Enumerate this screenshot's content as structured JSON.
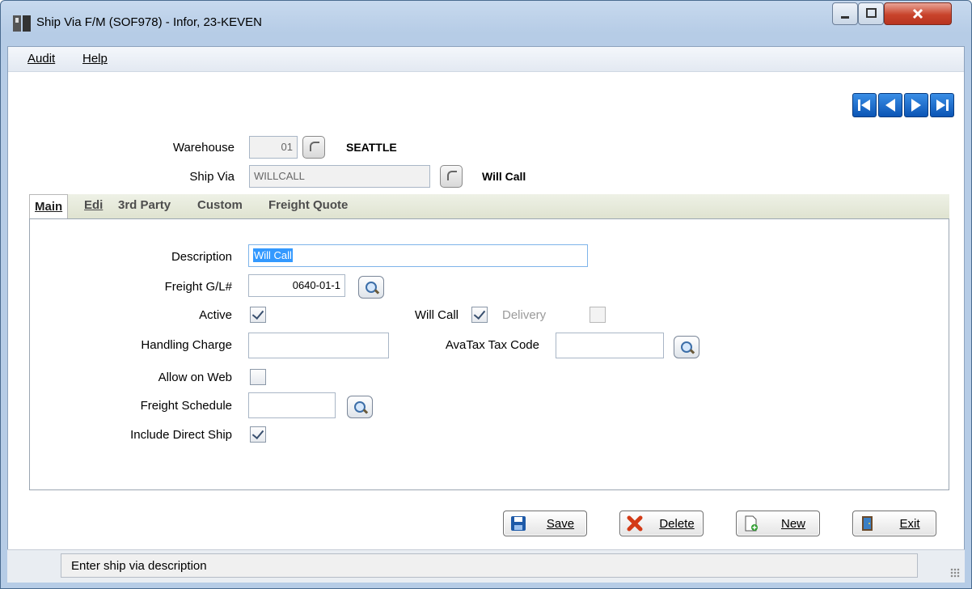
{
  "window": {
    "title": "Ship Via F/M (SOF978) - Infor, 23-KEVEN"
  },
  "menu": [
    "Audit",
    "Help"
  ],
  "header": {
    "warehouse_label": "Warehouse",
    "warehouse_value": "01",
    "warehouse_name": "SEATTLE",
    "shipvia_label": "Ship Via",
    "shipvia_value": "WILLCALL",
    "shipvia_name": "Will Call"
  },
  "tabs": [
    "Main",
    "Edi",
    "3rd Party",
    "Custom",
    "Freight Quote"
  ],
  "form": {
    "description_label": "Description",
    "description_value": "Will Call",
    "freight_gl_label": "Freight G/L#",
    "freight_gl_value": "0640-01-1",
    "active_label": "Active",
    "active_checked": true,
    "will_call_label": "Will Call",
    "will_call_checked": true,
    "delivery_label": "Delivery",
    "delivery_checked": false,
    "handling_label": "Handling Charge",
    "handling_value": "",
    "avatax_label": "AvaTax Tax Code",
    "avatax_value": "",
    "allow_web_label": "Allow on Web",
    "allow_web_checked": false,
    "freight_schedule_label": "Freight Schedule",
    "freight_schedule_value": "",
    "include_direct_label": "Include Direct Ship",
    "include_direct_checked": true
  },
  "buttons": {
    "save": "Save",
    "delete": "Delete",
    "new": "New",
    "exit": "Exit"
  },
  "status": {
    "text": "Enter ship via description"
  },
  "icons": {
    "nav": [
      "first-record-icon",
      "prev-record-icon",
      "next-record-icon",
      "last-record-icon"
    ],
    "lookup": "magnifier-icon"
  },
  "colors": {
    "nav_blue": "#0b55b5",
    "selection": "#3399ff"
  }
}
